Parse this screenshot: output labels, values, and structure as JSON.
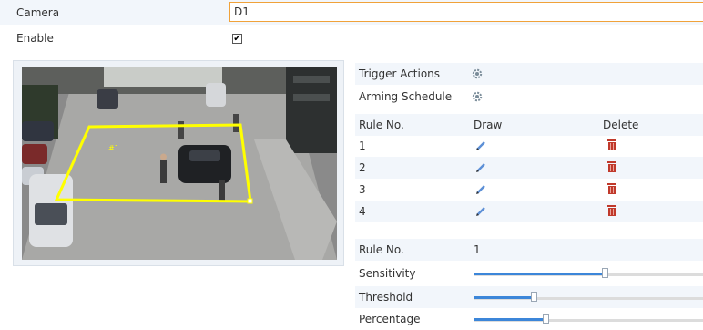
{
  "camera": {
    "label": "Camera",
    "value": "D1"
  },
  "enable": {
    "label": "Enable",
    "checked": true,
    "mark": "✔"
  },
  "preview": {
    "region_label": "#1",
    "region_color": "#ffff00"
  },
  "actions": {
    "trigger_label": "Trigger Actions",
    "arming_label": "Arming Schedule",
    "icon": "gear-icon"
  },
  "rules": {
    "headers": {
      "rule_no": "Rule No.",
      "draw": "Draw",
      "delete": "Delete"
    },
    "items": [
      {
        "no": "1"
      },
      {
        "no": "2"
      },
      {
        "no": "3"
      },
      {
        "no": "4"
      }
    ],
    "draw_icon": "pencil-icon",
    "delete_icon": "trash-icon",
    "delete_color": "#c0392b"
  },
  "settings": {
    "rule_no_label": "Rule No.",
    "rule_no_value": "1",
    "sensitivity": {
      "label": "Sensitivity",
      "level": 0.55
    },
    "threshold": {
      "label": "Threshold",
      "level": 0.25
    },
    "percentage": {
      "label": "Percentage",
      "level": 0.3
    }
  },
  "colors": {
    "accent": "#3c86d9",
    "focus_border": "#f0a23a",
    "shade": "#f2f6fb"
  }
}
